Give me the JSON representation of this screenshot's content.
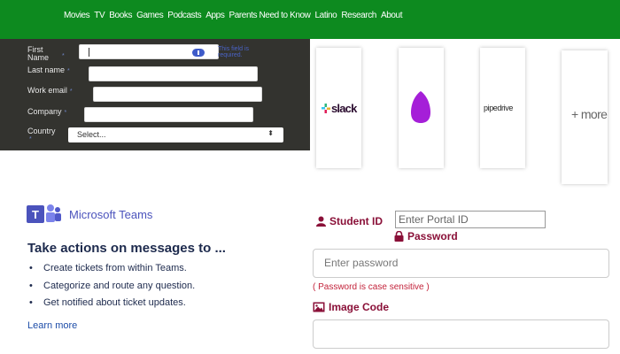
{
  "nav": {
    "items": [
      "Movies",
      "TV",
      "Books",
      "Games",
      "Podcasts",
      "Apps",
      "Parents Need to Know",
      "Latino",
      "Research",
      "About"
    ]
  },
  "form": {
    "first_name_label": "First Name",
    "first_name_error": "This field is required.",
    "last_name_label": "Last name",
    "work_email_label": "Work email",
    "company_label": "Company",
    "country_label": "Country",
    "required_mark": "*",
    "country_value": "Select..."
  },
  "integrations": {
    "slack_label": "slack",
    "pipedrive_label": "pipedrive",
    "more_label": "+ more"
  },
  "teams": {
    "brand": "Microsoft Teams",
    "heading": "Take actions on messages to ...",
    "bullets": [
      "Create tickets from within Teams.",
      "Categorize and route any question.",
      "Get notified about ticket updates."
    ],
    "link": "Learn more"
  },
  "login": {
    "student_id_label": "Student ID",
    "student_id_placeholder": "Enter Portal ID",
    "password_label": "Password",
    "password_placeholder": "Enter password",
    "password_hint": "( Password is case sensitive )",
    "image_code_label": "Image Code"
  },
  "colors": {
    "nav_green": "#0d8a1f",
    "form_dark": "#33332f",
    "teams_purple": "#4b53bc",
    "login_maroon": "#8a1038"
  }
}
